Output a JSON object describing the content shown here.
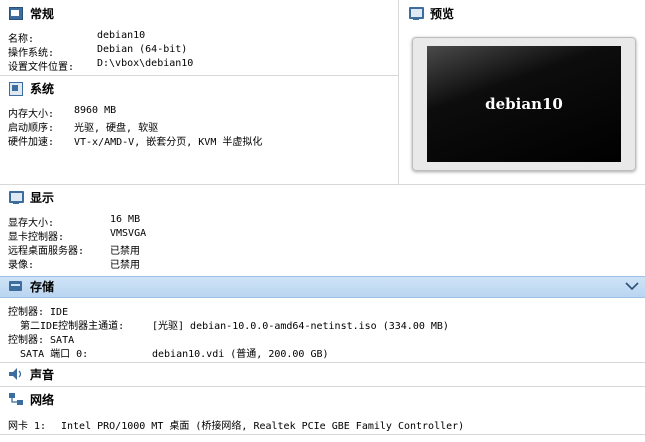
{
  "general": {
    "title": "常规",
    "rows": [
      {
        "label": "名称:",
        "value": "debian10"
      },
      {
        "label": "操作系统:",
        "value": "Debian (64-bit)"
      },
      {
        "label": "设置文件位置:",
        "value": "D:\\vbox\\debian10"
      }
    ]
  },
  "preview": {
    "title": "预览",
    "screen_text": "debian10"
  },
  "system": {
    "title": "系统",
    "rows": [
      {
        "label": "内存大小:",
        "value": "8960 MB"
      },
      {
        "label": "启动顺序:",
        "value": "光驱, 硬盘, 软驱"
      },
      {
        "label": "硬件加速:",
        "value": "VT-x/AMD-V, 嵌套分页, KVM 半虚拟化"
      }
    ]
  },
  "display": {
    "title": "显示",
    "rows": [
      {
        "label": "显存大小:",
        "value": "16 MB"
      },
      {
        "label": "显卡控制器:",
        "value": "VMSVGA"
      },
      {
        "label": "远程桌面服务器:",
        "value": "已禁用"
      },
      {
        "label": "录像:",
        "value": "已禁用"
      }
    ]
  },
  "storage": {
    "title": "存储",
    "lines": [
      {
        "label": "控制器: IDE",
        "value": ""
      },
      {
        "label": "  第二IDE控制器主通道:",
        "value": "[光驱] debian-10.0.0-amd64-netinst.iso (334.00 MB)"
      },
      {
        "label": "控制器: SATA",
        "value": ""
      },
      {
        "label": "  SATA 端口 0:",
        "value": "debian10.vdi (普通, 200.00 GB)"
      }
    ]
  },
  "audio": {
    "title": "声音"
  },
  "network": {
    "title": "网络",
    "rows": [
      {
        "label": "网卡 1:",
        "value": "Intel PRO/1000 MT 桌面 (桥接网络, Realtek PCIe GBE Family Controller)"
      }
    ]
  },
  "colors": {
    "accent": "#3c6d9e",
    "storage_bar": "#c3dbf4"
  }
}
